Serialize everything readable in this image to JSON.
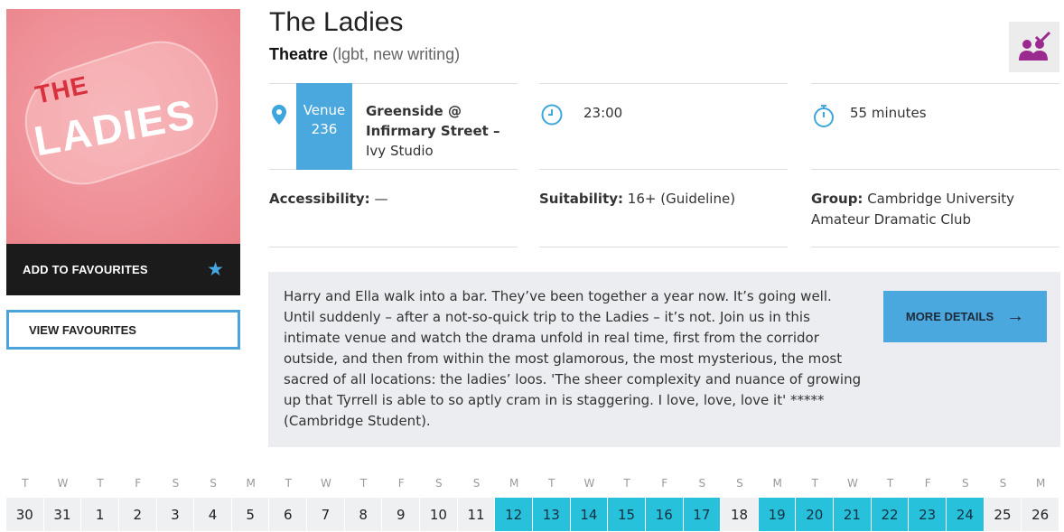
{
  "show": {
    "title": "The Ladies",
    "genre": "Theatre",
    "tags": "(lgbt, new writing)",
    "poster_text_top": "THE",
    "poster_text_main": "LADIES"
  },
  "actions": {
    "add_to_favourites": "ADD TO FAVOURITES",
    "view_favourites": "VIEW FAVOURITES",
    "more_details": "MORE DETAILS"
  },
  "venue": {
    "label": "Venue",
    "number": "236",
    "name_line1": "Greenside @",
    "name_line2": "Infirmary Street –",
    "studio": "Ivy Studio"
  },
  "time": "23:00",
  "duration": "55 minutes",
  "accessibility": {
    "label": "Accessibility:",
    "value": " —"
  },
  "suitability": {
    "label": "Suitability:",
    "value": " 16+ (Guideline)"
  },
  "group": {
    "label": "Group:",
    "value": " Cambridge University Amateur Dramatic Club"
  },
  "description": "Harry and Ella walk into a bar. They’ve been together a year now. It’s going well. Until suddenly – after a not-so-quick trip to the Ladies – it’s not. Join us in this intimate venue and watch the drama unfold in real time, first from the corridor outside, and then from within the most glamorous, the most mysterious, the most sacred of all locations: the ladies’ loos. 'The sheer complexity and nuance of growing up that Tyrrell is able to so aptly cram in is staggering. I love, love, love it' ***** (Cambridge Student).",
  "calendar": {
    "days": [
      {
        "dow": "T",
        "date": "30",
        "active": false
      },
      {
        "dow": "W",
        "date": "31",
        "active": false
      },
      {
        "dow": "T",
        "date": "1",
        "active": false
      },
      {
        "dow": "F",
        "date": "2",
        "active": false
      },
      {
        "dow": "S",
        "date": "3",
        "active": false
      },
      {
        "dow": "S",
        "date": "4",
        "active": false
      },
      {
        "dow": "M",
        "date": "5",
        "active": false
      },
      {
        "dow": "T",
        "date": "6",
        "active": false
      },
      {
        "dow": "W",
        "date": "7",
        "active": false
      },
      {
        "dow": "T",
        "date": "8",
        "active": false
      },
      {
        "dow": "F",
        "date": "9",
        "active": false
      },
      {
        "dow": "S",
        "date": "10",
        "active": false
      },
      {
        "dow": "S",
        "date": "11",
        "active": false
      },
      {
        "dow": "M",
        "date": "12",
        "active": true
      },
      {
        "dow": "T",
        "date": "13",
        "active": true
      },
      {
        "dow": "W",
        "date": "14",
        "active": true
      },
      {
        "dow": "T",
        "date": "15",
        "active": true
      },
      {
        "dow": "F",
        "date": "16",
        "active": true
      },
      {
        "dow": "S",
        "date": "17",
        "active": true
      },
      {
        "dow": "S",
        "date": "18",
        "active": false
      },
      {
        "dow": "M",
        "date": "19",
        "active": true
      },
      {
        "dow": "T",
        "date": "20",
        "active": true
      },
      {
        "dow": "W",
        "date": "21",
        "active": true
      },
      {
        "dow": "T",
        "date": "22",
        "active": true
      },
      {
        "dow": "F",
        "date": "23",
        "active": true
      },
      {
        "dow": "S",
        "date": "24",
        "active": true
      },
      {
        "dow": "S",
        "date": "25",
        "active": false
      },
      {
        "dow": "M",
        "date": "26",
        "active": false
      }
    ]
  },
  "icons": {
    "venue": "map-pin-icon",
    "time": "clock-icon",
    "duration": "stopwatch-icon",
    "favourite": "star-icon",
    "badge": "group-check-icon",
    "more": "arrow-right-icon"
  },
  "colors": {
    "accent_blue": "#4ba8de",
    "active_day": "#27c1dc",
    "badge_purple": "#9b2a8f"
  }
}
